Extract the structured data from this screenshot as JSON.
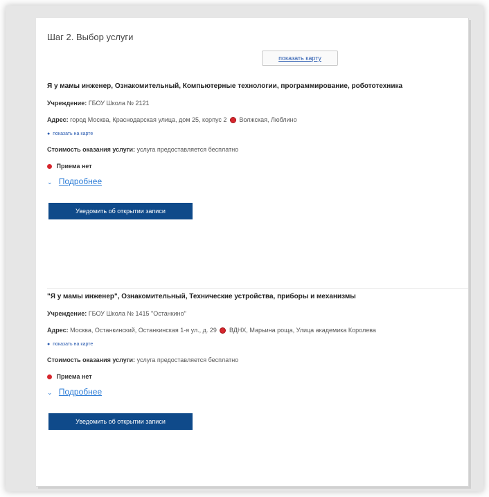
{
  "step_title": "Шаг 2. Выбор услуги",
  "map_button_label": "показать карту",
  "services": [
    {
      "title": "Я у мамы инженер, Ознакомительный, Компьютерные технологии, программирование, робототехника",
      "institution_label": "Учреждение:",
      "institution_value": "ГБОУ Школа № 2121",
      "address_label": "Адрес:",
      "address_value": "город Москва, Краснодарская улица, дом 25, корпус 2",
      "metro": "Волжская, Люблино",
      "show_on_map": "показать на карте",
      "cost_label": "Стоимость оказания услуги:",
      "cost_value": "услуга предоставляется бесплатно",
      "reception_status": "Приема нет",
      "details_label": "Подробнее",
      "notify_button": "Уведомить об открытии записи"
    },
    {
      "title": "\"Я у мамы инженер\", Ознакомительный, Технические устройства, приборы и механизмы",
      "institution_label": "Учреждение:",
      "institution_value": "ГБОУ Школа № 1415 \"Останкино\"",
      "address_label": "Адрес:",
      "address_value": "Москва, Останкинский, Останкинская 1-я ул., д. 29",
      "metro": "ВДНХ, Марьина роща, Улица академика Королева",
      "show_on_map": "показать на карте",
      "cost_label": "Стоимость оказания услуги:",
      "cost_value": "услуга предоставляется бесплатно",
      "reception_status": "Приема нет",
      "details_label": "Подробнее",
      "notify_button": "Уведомить об открытии записи"
    }
  ],
  "colors": {
    "accent": "#0f4a8a",
    "link": "#2a7bd6",
    "status_red": "#d6262d"
  }
}
